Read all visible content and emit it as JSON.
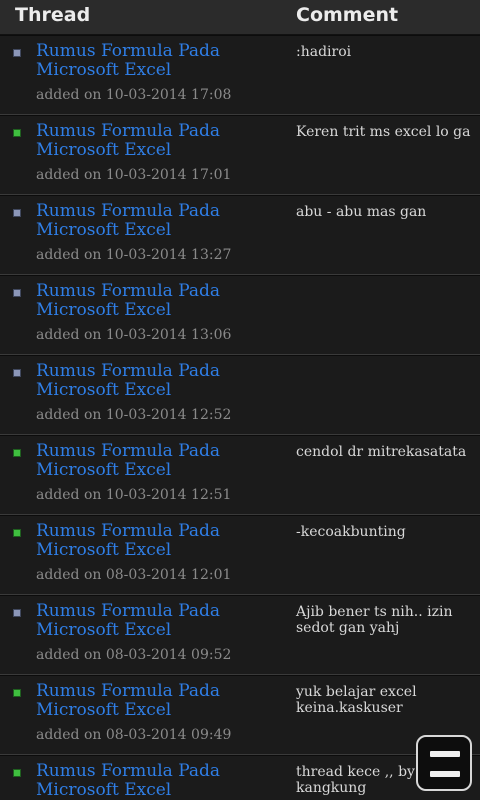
{
  "header": {
    "thread_label": "Thread",
    "comment_label": "Comment"
  },
  "rows": [
    {
      "title": "Rumus Formula Pada Microsoft Excel",
      "added": "added on 10-03-2014 17:08",
      "comment": ":hadiroi",
      "marker": "gray"
    },
    {
      "title": "Rumus Formula Pada Microsoft Excel",
      "added": "added on 10-03-2014 17:01",
      "comment": "Keren trit ms excel lo ga",
      "marker": "green"
    },
    {
      "title": "Rumus Formula Pada Microsoft Excel",
      "added": "added on 10-03-2014 13:27",
      "comment": "abu - abu mas gan",
      "marker": "gray"
    },
    {
      "title": "Rumus Formula Pada Microsoft Excel",
      "added": "added on 10-03-2014 13:06",
      "comment": "",
      "marker": "gray"
    },
    {
      "title": "Rumus Formula Pada Microsoft Excel",
      "added": "added on 10-03-2014 12:52",
      "comment": "",
      "marker": "gray"
    },
    {
      "title": "Rumus Formula Pada Microsoft Excel",
      "added": "added on 10-03-2014 12:51",
      "comment": "cendol dr mitrekasatata",
      "marker": "green"
    },
    {
      "title": "Rumus Formula Pada Microsoft Excel",
      "added": "added on 08-03-2014 12:01",
      "comment": "-kecoakbunting",
      "marker": "green"
    },
    {
      "title": "Rumus Formula Pada Microsoft Excel",
      "added": "added on 08-03-2014 09:52",
      "comment": "Ajib bener ts nih.. izin sedot gan yahj",
      "marker": "gray"
    },
    {
      "title": "Rumus Formula Pada Microsoft Excel",
      "added": "added on 08-03-2014 09:49",
      "comment": "yuk belajar excel keina.kaskuser",
      "marker": "green"
    },
    {
      "title": "Rumus Formula Pada Microsoft Excel",
      "added": "",
      "comment": "thread kece ,, by : kangkung",
      "marker": "green"
    }
  ],
  "colors": {
    "background": "#1b1b1b",
    "link": "#2f7ee6",
    "marker_green": "#3fbf3f",
    "marker_gray": "#8c97b8"
  },
  "icons": {
    "menu": "menu-icon"
  }
}
